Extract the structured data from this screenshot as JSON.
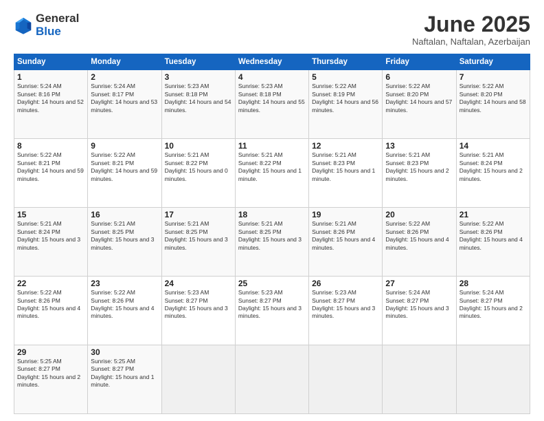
{
  "logo": {
    "general": "General",
    "blue": "Blue"
  },
  "title": "June 2025",
  "location": "Naftalan, Naftalan, Azerbaijan",
  "headers": [
    "Sunday",
    "Monday",
    "Tuesday",
    "Wednesday",
    "Thursday",
    "Friday",
    "Saturday"
  ],
  "weeks": [
    [
      {
        "day": "1",
        "sunrise": "5:24 AM",
        "sunset": "8:16 PM",
        "daylight": "14 hours and 52 minutes."
      },
      {
        "day": "2",
        "sunrise": "5:24 AM",
        "sunset": "8:17 PM",
        "daylight": "14 hours and 53 minutes."
      },
      {
        "day": "3",
        "sunrise": "5:23 AM",
        "sunset": "8:18 PM",
        "daylight": "14 hours and 54 minutes."
      },
      {
        "day": "4",
        "sunrise": "5:23 AM",
        "sunset": "8:18 PM",
        "daylight": "14 hours and 55 minutes."
      },
      {
        "day": "5",
        "sunrise": "5:22 AM",
        "sunset": "8:19 PM",
        "daylight": "14 hours and 56 minutes."
      },
      {
        "day": "6",
        "sunrise": "5:22 AM",
        "sunset": "8:20 PM",
        "daylight": "14 hours and 57 minutes."
      },
      {
        "day": "7",
        "sunrise": "5:22 AM",
        "sunset": "8:20 PM",
        "daylight": "14 hours and 58 minutes."
      }
    ],
    [
      {
        "day": "8",
        "sunrise": "5:22 AM",
        "sunset": "8:21 PM",
        "daylight": "14 hours and 59 minutes."
      },
      {
        "day": "9",
        "sunrise": "5:22 AM",
        "sunset": "8:21 PM",
        "daylight": "14 hours and 59 minutes."
      },
      {
        "day": "10",
        "sunrise": "5:21 AM",
        "sunset": "8:22 PM",
        "daylight": "15 hours and 0 minutes."
      },
      {
        "day": "11",
        "sunrise": "5:21 AM",
        "sunset": "8:22 PM",
        "daylight": "15 hours and 1 minute."
      },
      {
        "day": "12",
        "sunrise": "5:21 AM",
        "sunset": "8:23 PM",
        "daylight": "15 hours and 1 minute."
      },
      {
        "day": "13",
        "sunrise": "5:21 AM",
        "sunset": "8:23 PM",
        "daylight": "15 hours and 2 minutes."
      },
      {
        "day": "14",
        "sunrise": "5:21 AM",
        "sunset": "8:24 PM",
        "daylight": "15 hours and 2 minutes."
      }
    ],
    [
      {
        "day": "15",
        "sunrise": "5:21 AM",
        "sunset": "8:24 PM",
        "daylight": "15 hours and 3 minutes."
      },
      {
        "day": "16",
        "sunrise": "5:21 AM",
        "sunset": "8:25 PM",
        "daylight": "15 hours and 3 minutes."
      },
      {
        "day": "17",
        "sunrise": "5:21 AM",
        "sunset": "8:25 PM",
        "daylight": "15 hours and 3 minutes."
      },
      {
        "day": "18",
        "sunrise": "5:21 AM",
        "sunset": "8:25 PM",
        "daylight": "15 hours and 3 minutes."
      },
      {
        "day": "19",
        "sunrise": "5:21 AM",
        "sunset": "8:26 PM",
        "daylight": "15 hours and 4 minutes."
      },
      {
        "day": "20",
        "sunrise": "5:22 AM",
        "sunset": "8:26 PM",
        "daylight": "15 hours and 4 minutes."
      },
      {
        "day": "21",
        "sunrise": "5:22 AM",
        "sunset": "8:26 PM",
        "daylight": "15 hours and 4 minutes."
      }
    ],
    [
      {
        "day": "22",
        "sunrise": "5:22 AM",
        "sunset": "8:26 PM",
        "daylight": "15 hours and 4 minutes."
      },
      {
        "day": "23",
        "sunrise": "5:22 AM",
        "sunset": "8:26 PM",
        "daylight": "15 hours and 4 minutes."
      },
      {
        "day": "24",
        "sunrise": "5:23 AM",
        "sunset": "8:27 PM",
        "daylight": "15 hours and 3 minutes."
      },
      {
        "day": "25",
        "sunrise": "5:23 AM",
        "sunset": "8:27 PM",
        "daylight": "15 hours and 3 minutes."
      },
      {
        "day": "26",
        "sunrise": "5:23 AM",
        "sunset": "8:27 PM",
        "daylight": "15 hours and 3 minutes."
      },
      {
        "day": "27",
        "sunrise": "5:24 AM",
        "sunset": "8:27 PM",
        "daylight": "15 hours and 3 minutes."
      },
      {
        "day": "28",
        "sunrise": "5:24 AM",
        "sunset": "8:27 PM",
        "daylight": "15 hours and 2 minutes."
      }
    ],
    [
      {
        "day": "29",
        "sunrise": "5:25 AM",
        "sunset": "8:27 PM",
        "daylight": "15 hours and 2 minutes."
      },
      {
        "day": "30",
        "sunrise": "5:25 AM",
        "sunset": "8:27 PM",
        "daylight": "15 hours and 1 minute."
      },
      null,
      null,
      null,
      null,
      null
    ]
  ]
}
